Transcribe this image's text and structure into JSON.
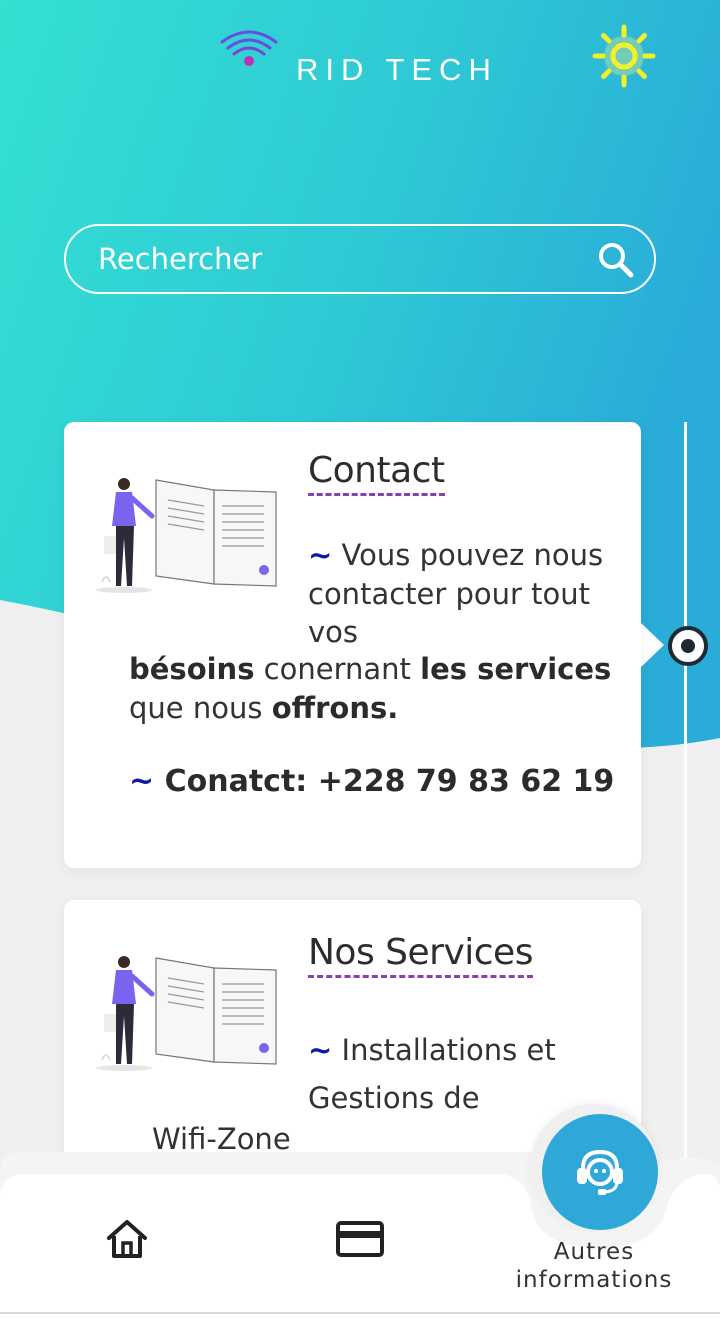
{
  "header": {
    "brand": "RID TECH",
    "logo_icon": "wifi-icon",
    "theme_icon": "sun-icon"
  },
  "search": {
    "placeholder": "Rechercher",
    "icon": "search-icon"
  },
  "cards": [
    {
      "title": "Contact",
      "illustration": "person-reading-book-illustration",
      "tilde": "~",
      "text_intro": " Vous pouvez nous contacter pour tout vos",
      "text_b1": "bésoins",
      "text_n1": " conernant ",
      "text_b2": "les services",
      "text_n2": " que nous ",
      "text_b3": "offrons.",
      "phone": "Conatct: +228 79 83 62 19"
    },
    {
      "title": "Nos Services",
      "illustration": "person-reading-book-illustration",
      "tilde": "~",
      "text_a": " Installations et Gestions de",
      "text_b": "Wifi-Zone"
    }
  ],
  "bottom_nav": {
    "items": [
      {
        "icon": "home-icon"
      },
      {
        "icon": "credit-card-icon"
      }
    ],
    "support_icon": "headset-support-icon",
    "support_label_line1": "Autres",
    "support_label_line2": "informations"
  },
  "colors": {
    "gradient_start": "#33dcd2",
    "gradient_end": "#2aaed8",
    "accent_purple": "#8a3fb0",
    "tilde_blue": "#0e1aa8",
    "support_button": "#2fa8d8",
    "sun_yellow": "#f3ef2a"
  }
}
